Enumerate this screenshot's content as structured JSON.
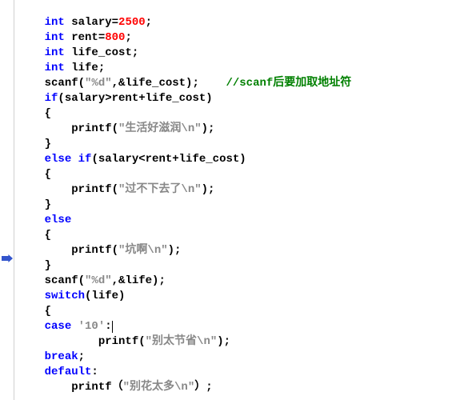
{
  "code": {
    "line00_p1": "",
    "line01_kw": "int",
    "line01_txt": " salary=",
    "line01_lit": "2500",
    "line01_end": ";",
    "line02_kw": "int",
    "line02_txt": " rent=",
    "line02_lit": "800",
    "line02_end": ";",
    "line03_kw": "int",
    "line03_txt": " life_cost;",
    "line04_kw": "int",
    "line04_txt": " life;",
    "line05_a": "scanf(",
    "line05_str": "\"%d\"",
    "line05_b": ",&life_cost);    ",
    "line05_cmt": "//scanf后要加取地址符",
    "line06_kw": "if",
    "line06_txt": "(salary>rent+life_cost)",
    "line07": "{",
    "line08_a": "    printf(",
    "line08_str": "\"生活好滋润\\n\"",
    "line08_b": ");",
    "line09": "}",
    "line10_kw1": "else",
    "line10_sp": " ",
    "line10_kw2": "if",
    "line10_txt": "(salary<rent+life_cost)",
    "line11": "{",
    "line12_a": "    printf(",
    "line12_str": "\"过不下去了\\n\"",
    "line12_b": ");",
    "line13": "}",
    "line14_kw": "else",
    "line15": "{",
    "line16_a": "    printf(",
    "line16_str": "\"坑啊\\n\"",
    "line16_b": ");",
    "line17": "}",
    "line18_a": "scanf(",
    "line18_str": "\"%d\"",
    "line18_b": ",&life);",
    "line19_kw": "switch",
    "line19_txt": "(life)",
    "line20": "{",
    "line21_kw": "case",
    "line21_sp": " ",
    "line21_str": "'10'",
    "line21_end": ":",
    "line22_a": "        printf(",
    "line22_str": "\"别太节省\\n\"",
    "line22_b": ");",
    "line23_kw": "break",
    "line23_end": ";",
    "line24_kw": "default",
    "line24_end": ":",
    "line25_a": "    printf（",
    "line25_str": "\"别花太多\\n\"",
    "line25_b": "）;"
  },
  "indent": "    "
}
